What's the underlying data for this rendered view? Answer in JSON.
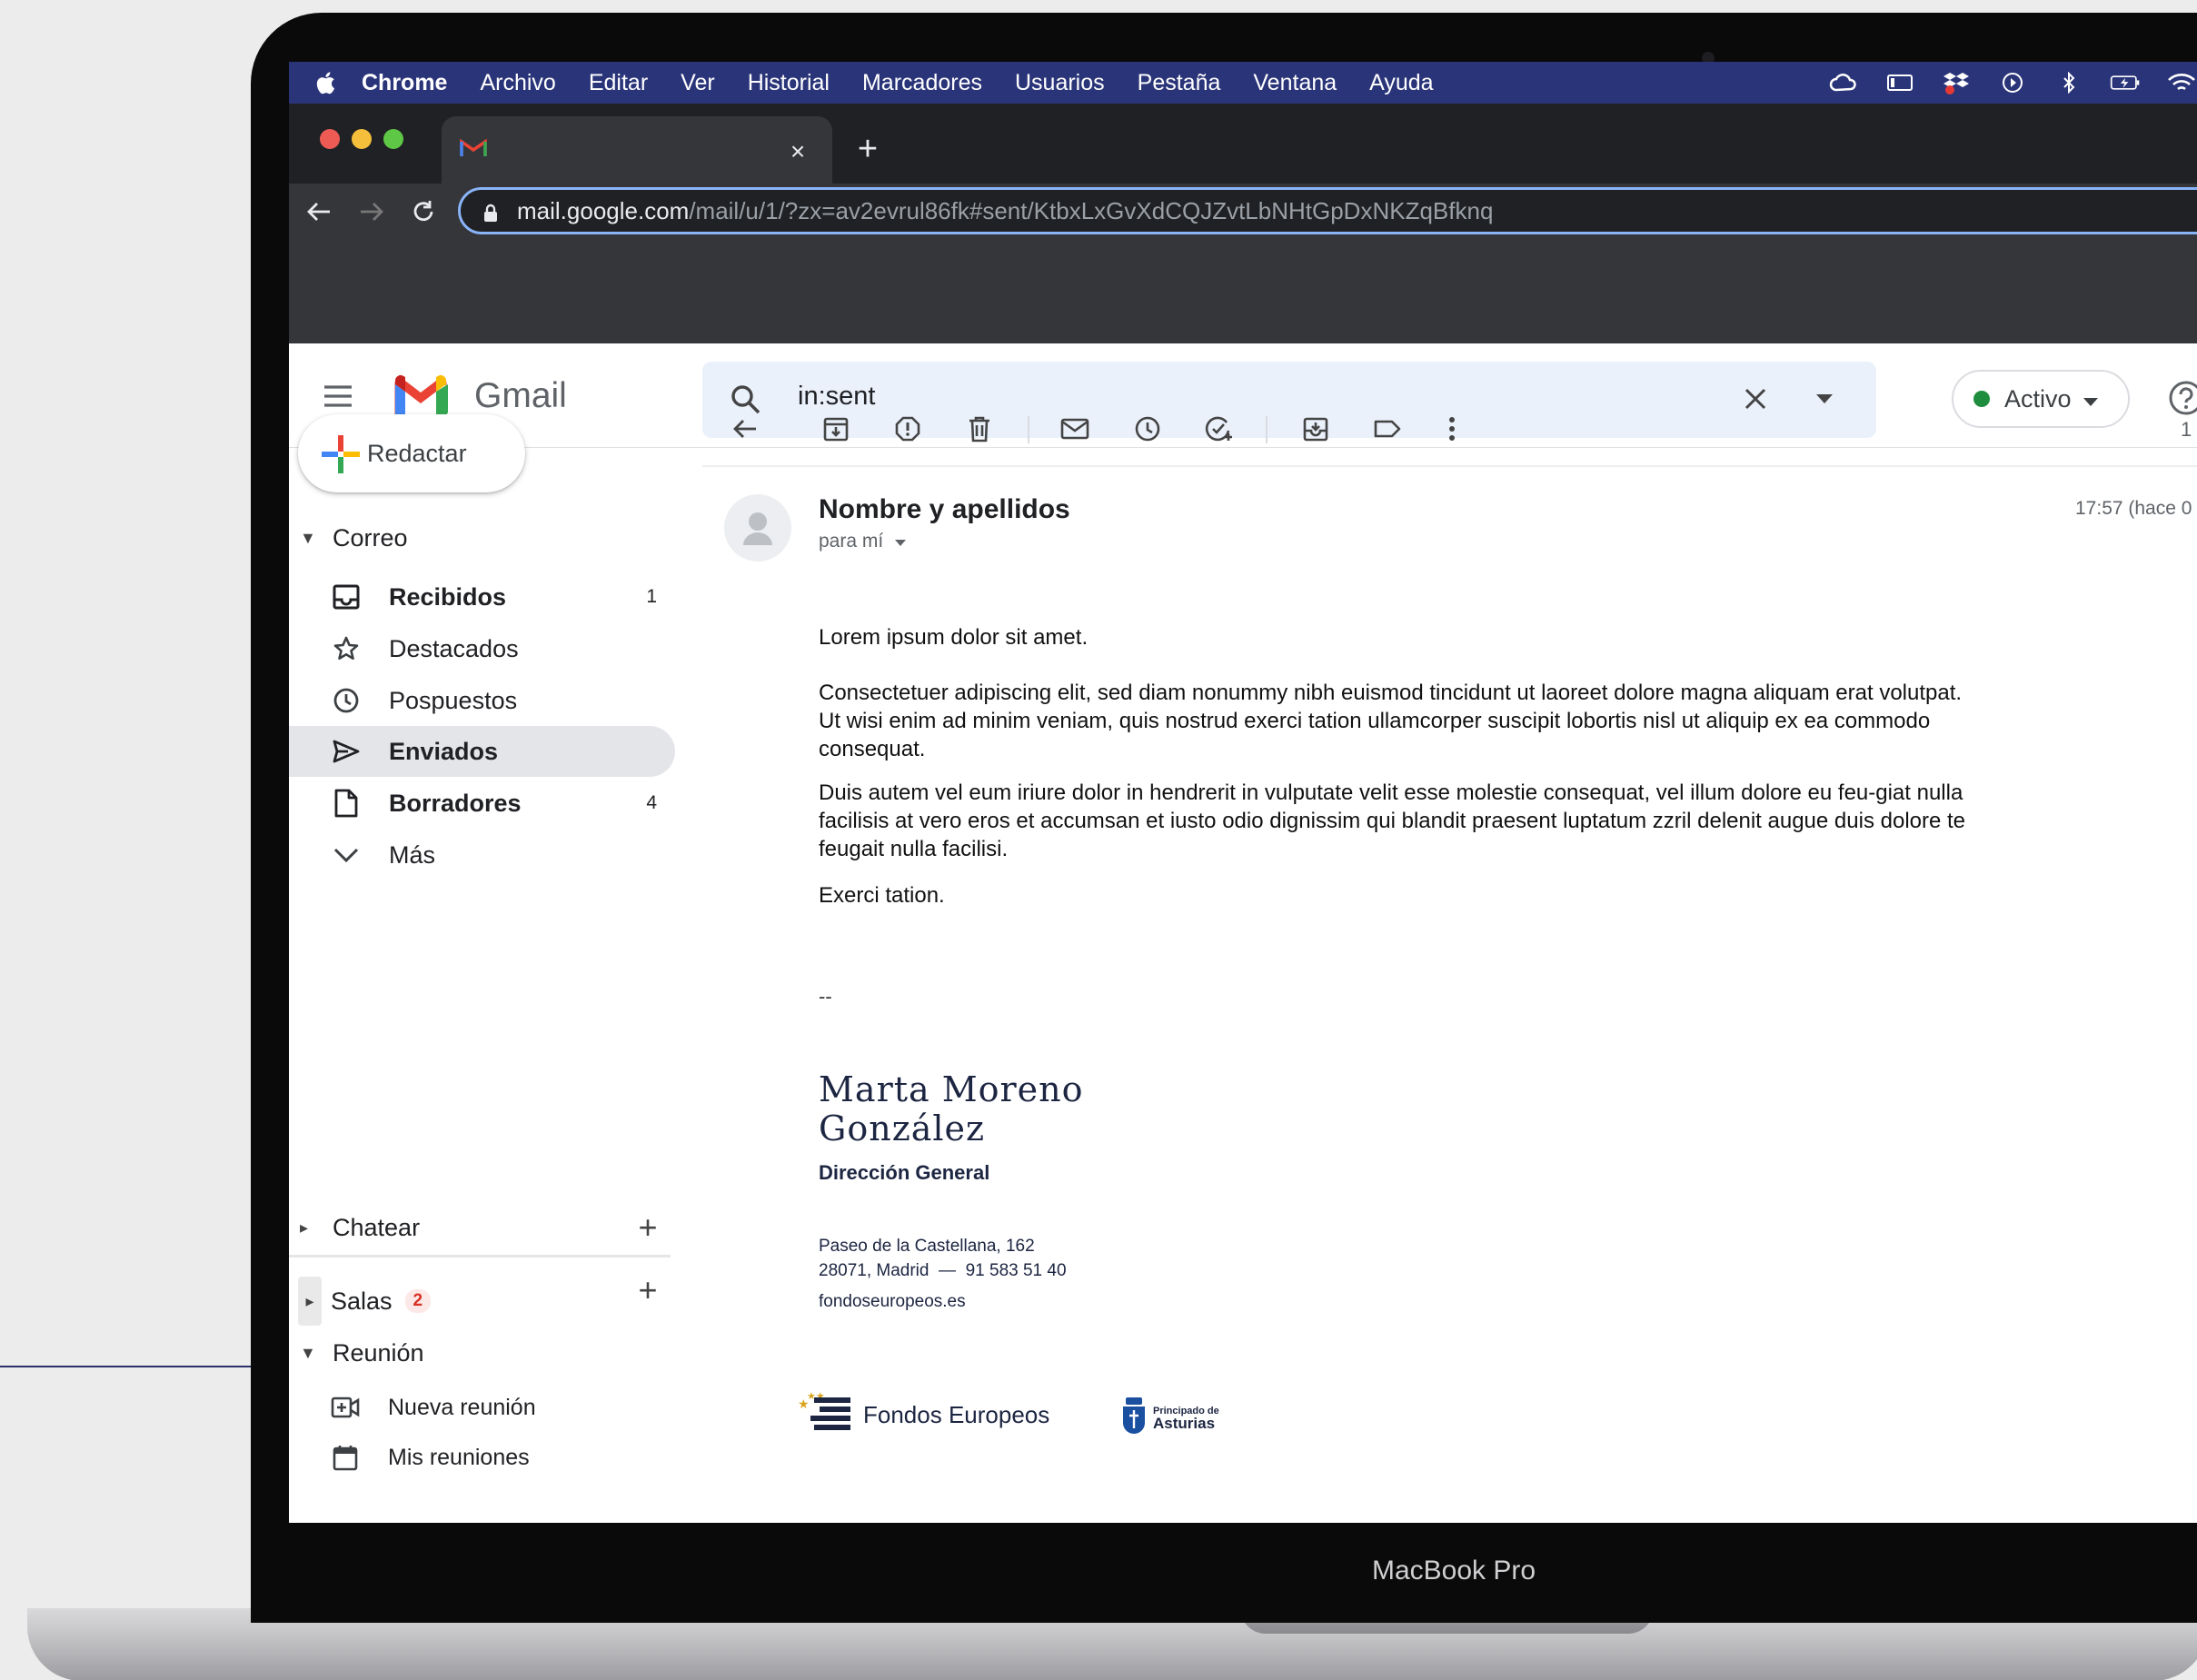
{
  "macos_menubar": {
    "app": "Chrome",
    "items": [
      "Archivo",
      "Editar",
      "Ver",
      "Historial",
      "Marcadores",
      "Usuarios",
      "Pestaña",
      "Ventana",
      "Ayuda"
    ]
  },
  "browser": {
    "tab_close": "×",
    "new_tab": "+",
    "url_host": "mail.google.com",
    "url_path": "/mail/u/1/?zx=av2evrul86fk#sent/KtbxLxGvXdCQJZvtLbNHtGpDxNKZqBfknq"
  },
  "gmail": {
    "logo_text": "Gmail",
    "search_value": "in:sent",
    "status_label": "Activo",
    "compose_label": "Redactar",
    "page_counter": "1",
    "mail_section": "Correo",
    "nav": [
      {
        "label": "Recibidos",
        "count": "1"
      },
      {
        "label": "Destacados",
        "count": ""
      },
      {
        "label": "Pospuestos",
        "count": ""
      },
      {
        "label": "Enviados",
        "count": ""
      },
      {
        "label": "Borradores",
        "count": "4"
      },
      {
        "label": "Más",
        "count": ""
      }
    ],
    "chat_section": "Chatear",
    "rooms_section": "Salas",
    "rooms_badge": "2",
    "meet_section": "Reunión",
    "meet_items": [
      "Nueva reunión",
      "Mis reuniones"
    ]
  },
  "email": {
    "sender": "Nombre y apellidos",
    "recipient": "para mí",
    "time": "17:57 (hace 0",
    "paragraphs": [
      "Lorem ipsum dolor sit amet.",
      "Consectetuer adipiscing elit, sed diam nonummy nibh euismod tincidunt ut laoreet dolore magna aliquam erat volutpat. Ut wisi enim ad minim veniam, quis nostrud exerci tation ullamcorper suscipit lobortis nisl ut aliquip ex ea commodo consequat.",
      "Duis autem vel eum iriure dolor in hendrerit in vulputate velit esse molestie consequat, vel illum dolore eu feu-giat nulla facilisis at vero eros et accumsan et iusto odio dignissim qui blandit praesent luptatum zzril delenit augue duis dolore te feugait nulla facilisi.",
      "Exerci tation."
    ],
    "signature": {
      "dash": "--",
      "name_line1": "Marta Moreno",
      "name_line2": "González",
      "title": "Dirección General",
      "address_line1": "Paseo de la Castellana, 162",
      "address_line2": "28071, Madrid  —  91 583 51 40",
      "website": "fondoseuropeos.es",
      "logo_fondos": "Fondos Europeos",
      "logo_asturias_small": "Principado de",
      "logo_asturias_big": "Asturias"
    }
  },
  "device": {
    "model": "MacBook Pro"
  },
  "colors": {
    "menubar": "#2a3479",
    "active_nav": "#e4e5e9",
    "status_dot": "#1e8e3e",
    "badge": "#d93025"
  }
}
